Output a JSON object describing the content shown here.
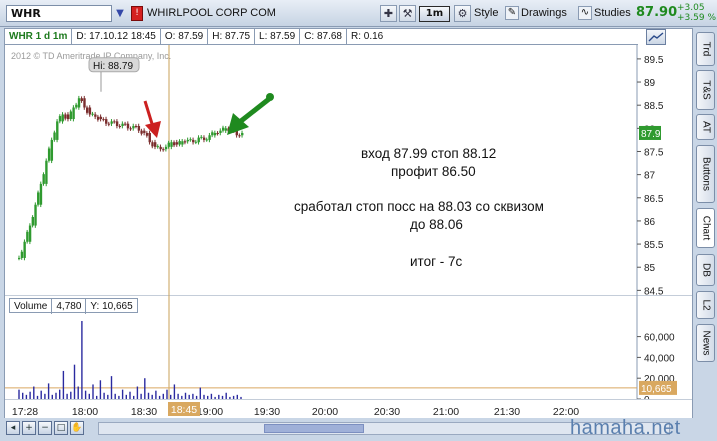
{
  "toolbar": {
    "symbol": "WHR",
    "company": "WHIRLPOOL CORP COM",
    "period": "1m",
    "style_label": "Style",
    "drawings_label": "Drawings",
    "studies_label": "Studies",
    "last_price": "87.90",
    "change_abs": "+3.05",
    "change_pct": "+3.59 %",
    "price_color": "#1f8a1f"
  },
  "info_bar": {
    "symbol_period": "WHR 1 d 1m",
    "date": "D: 17.10.12 18:45",
    "open": "O: 87.59",
    "high": "H: 87.75",
    "low": "L: 87.59",
    "close": "C: 87.68",
    "range": "R: 0.16"
  },
  "copyright": "2012 © TD Ameritrade IP Company, Inc.",
  "hi_label": "Hi: 88.79",
  "current_price_tag": "87.9",
  "volume_bar": {
    "label": "Volume",
    "value": "4,780",
    "y_value": "Y: 10,665"
  },
  "volume_tag": "10,665",
  "cursor_time_tag": "18:45",
  "notes": {
    "line1": "вход 87.99 стоп 88.12",
    "line2": "профит 86.50",
    "line3": "сработал стоп посс на 88.03 со сквизом",
    "line4": "до 88.06",
    "line5": "итог - 7с"
  },
  "side_tabs": [
    "Trd",
    "T&S",
    "AT",
    "Buttons",
    "Chart",
    "DB",
    "L2",
    "News"
  ],
  "watermark": "hamaha.net",
  "chart_data": {
    "type": "candlestick",
    "price_axis": {
      "range": [
        84.4,
        89.8
      ],
      "ticks": [
        "89.5",
        "89",
        "88.5",
        "88",
        "87.5",
        "87",
        "86.5",
        "86",
        "85.5",
        "85",
        "84.5"
      ]
    },
    "volume_axis": {
      "range": [
        0,
        75000
      ],
      "ticks": [
        "60,000",
        "40,000",
        "20,000",
        "0"
      ]
    },
    "time_axis": {
      "ticks": [
        "17:28",
        "18:00",
        "18:30",
        "19:00",
        "19:30",
        "20:00",
        "20:30",
        "21:00",
        "21:30",
        "22:00"
      ]
    },
    "high_marker": 88.79,
    "current_price": 87.9,
    "cursor_time": "18:45",
    "price_path": [
      [
        0,
        85.2
      ],
      [
        2,
        85.55
      ],
      [
        4,
        85.9
      ],
      [
        6,
        86.35
      ],
      [
        8,
        86.8
      ],
      [
        10,
        87.3
      ],
      [
        12,
        87.75
      ],
      [
        14,
        88.15
      ],
      [
        16,
        88.3
      ],
      [
        18,
        88.2
      ],
      [
        20,
        88.45
      ],
      [
        22,
        88.65
      ],
      [
        24,
        88.45
      ],
      [
        26,
        88.3
      ],
      [
        28,
        88.25
      ],
      [
        30,
        88.2
      ],
      [
        32,
        88.1
      ],
      [
        34,
        88.15
      ],
      [
        36,
        88.05
      ],
      [
        38,
        88.1
      ],
      [
        40,
        88.0
      ],
      [
        42,
        88.05
      ],
      [
        44,
        87.95
      ],
      [
        46,
        87.9
      ],
      [
        48,
        87.7
      ],
      [
        50,
        87.6
      ],
      [
        52,
        87.55
      ],
      [
        54,
        87.6
      ],
      [
        56,
        87.7
      ],
      [
        58,
        87.65
      ],
      [
        60,
        87.72
      ],
      [
        62,
        87.75
      ],
      [
        64,
        87.7
      ],
      [
        66,
        87.8
      ],
      [
        68,
        87.75
      ],
      [
        70,
        87.85
      ],
      [
        72,
        87.9
      ],
      [
        74,
        87.95
      ],
      [
        76,
        88.0
      ],
      [
        78,
        87.95
      ],
      [
        80,
        87.85
      ],
      [
        82,
        87.9
      ]
    ],
    "volume_values": [
      9000,
      6000,
      4000,
      7000,
      12000,
      3000,
      8000,
      5000,
      15000,
      4000,
      6000,
      9000,
      27000,
      5000,
      7000,
      33000,
      12000,
      75000,
      8000,
      5000,
      14000,
      3000,
      18000,
      6000,
      4000,
      22000,
      5000,
      3000,
      9000,
      4000,
      7000,
      3000,
      12000,
      5000,
      20000,
      6000,
      4000,
      8000,
      3000,
      5000,
      9000,
      4000,
      14000,
      5000,
      3000,
      6000,
      4000,
      5000,
      3000,
      11000,
      4000,
      3000,
      5000,
      2000,
      4000,
      3000,
      6000,
      2000,
      3000,
      4000,
      2000
    ],
    "annotations": [
      "red arrow down at entry",
      "green arrow down at stop"
    ],
    "grid": false
  }
}
